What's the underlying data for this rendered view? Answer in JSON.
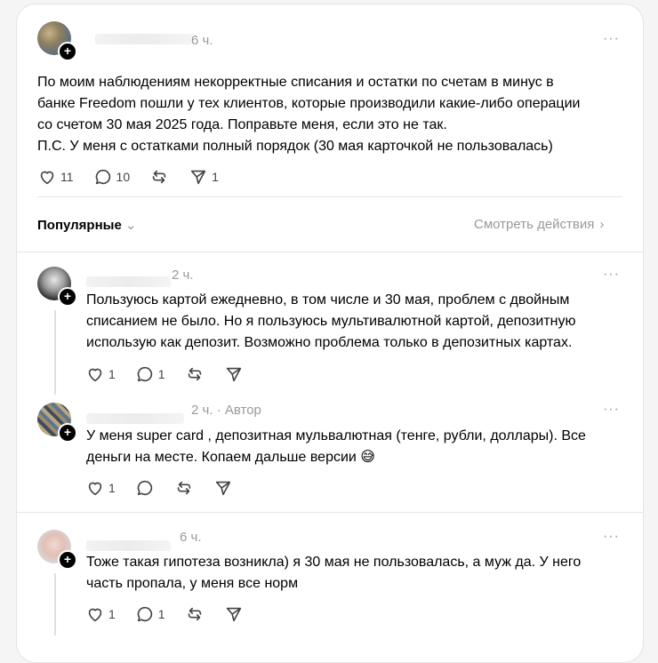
{
  "post": {
    "time": "6 ч.",
    "text_lines": [
      "По моим наблюдениям некорректные списания и остатки по счетам в минус в",
      "банке Freedom пошли у тех клиентов, которые производили какие-либо операции",
      "со счетом 30 мая 2025 года. Поправьте меня, если это не так.",
      "П.С. У меня с остатками полный порядок (30 мая карточкой не пользовалась)"
    ],
    "likes": "11",
    "replies": "10",
    "shares": "1"
  },
  "sort": {
    "label": "Популярные",
    "view_activity": "Смотреть действия"
  },
  "replies": [
    {
      "time": "2 ч.",
      "text_lines": [
        "Пользуюсь картой ежедневно, в том числе и 30 мая, проблем с двойным",
        "списанием не было. Но я пользуюсь мультивалютной картой, депозитную",
        "использую как депозит. Возможно проблема только в депозитных картах."
      ],
      "likes": "1",
      "replies": "1"
    },
    {
      "time": "2 ч.",
      "author_tag": "Автор",
      "text_lines": [
        "У меня super card , депозитная мульвалютная (тенге, рубли, доллары). Все",
        "деньги на месте. Копаем дальше версии 😅"
      ],
      "likes": "1",
      "replies": ""
    },
    {
      "time": "6 ч.",
      "text_lines": [
        "Тоже такая гипотеза возникла) я 30 мая не пользовалась, а муж да. У него",
        "часть пропала, у меня все норм"
      ],
      "likes": "1",
      "replies": "1"
    }
  ],
  "more_label": "···",
  "plus_label": "+"
}
